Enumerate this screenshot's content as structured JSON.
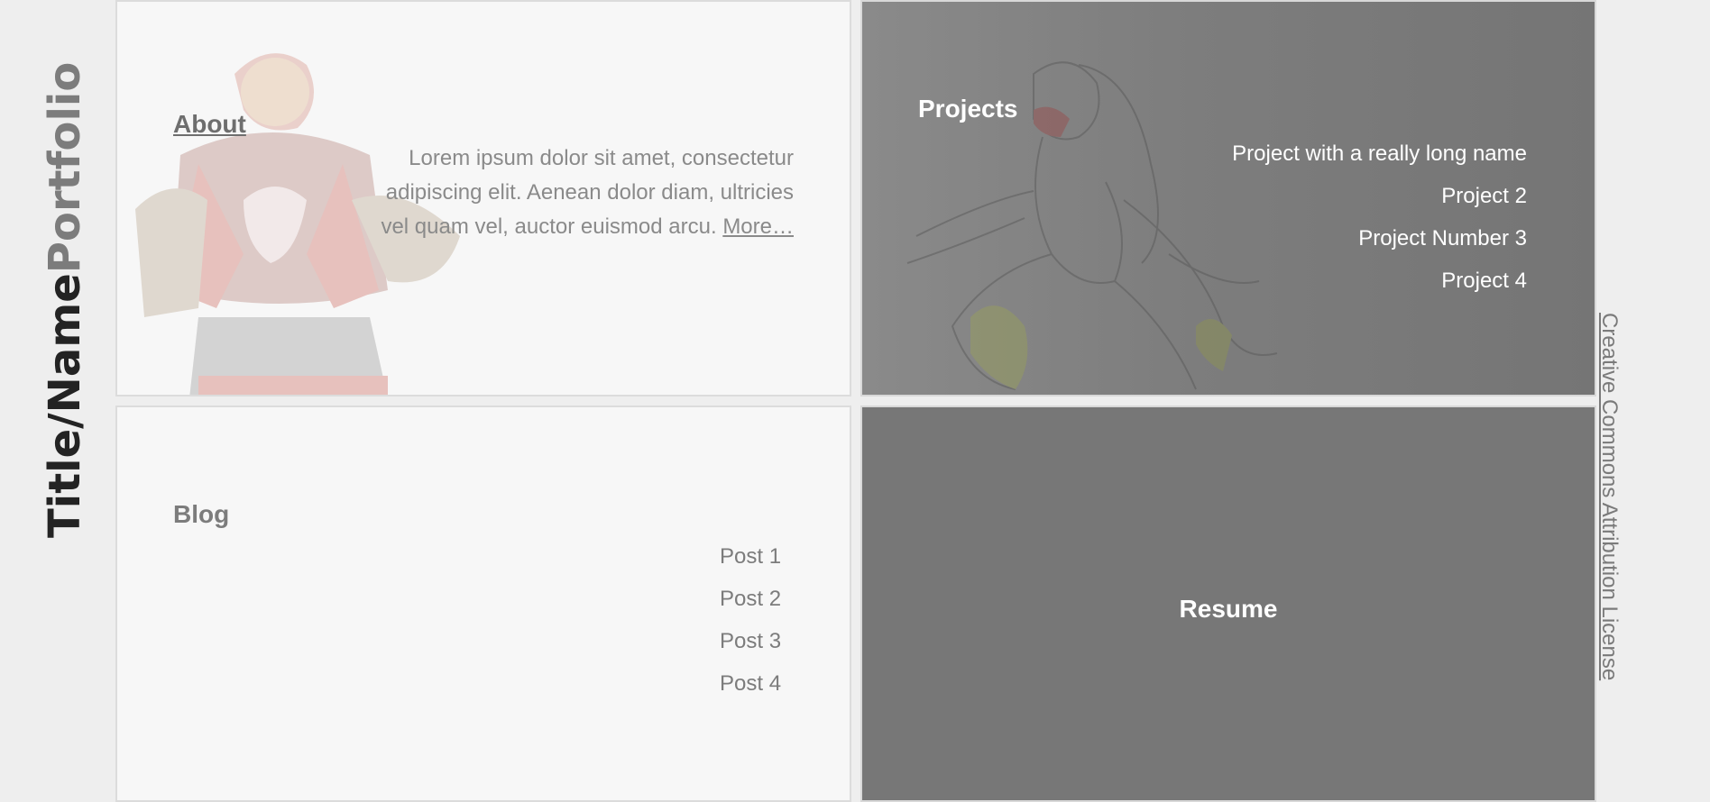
{
  "sidebar": {
    "title_strong": "Title/Name",
    "title_light": "Portfolio"
  },
  "about": {
    "heading": "About",
    "text": "Lorem ipsum dolor sit amet, consectetur adipiscing elit. Aenean dolor diam, ultricies vel quam vel, auctor euismod arcu.",
    "more_label": "More…"
  },
  "projects": {
    "heading": "Projects",
    "items": [
      {
        "label": "Project with a really long name"
      },
      {
        "label": "Project 2"
      },
      {
        "label": "Project Number 3"
      },
      {
        "label": "Project 4"
      }
    ]
  },
  "blog": {
    "heading": "Blog",
    "posts": [
      {
        "label": "Post 1"
      },
      {
        "label": "Post 2"
      },
      {
        "label": "Post 3"
      },
      {
        "label": "Post 4"
      }
    ]
  },
  "resume": {
    "heading": "Resume"
  },
  "footer": {
    "license_label": "Creative Commons Attribution License"
  },
  "colors": {
    "background": "#eeeeee",
    "light_panel": "#f7f7f7",
    "dark_panel": "#777777",
    "title_dark": "#232323",
    "title_light": "#7c7c7c"
  }
}
